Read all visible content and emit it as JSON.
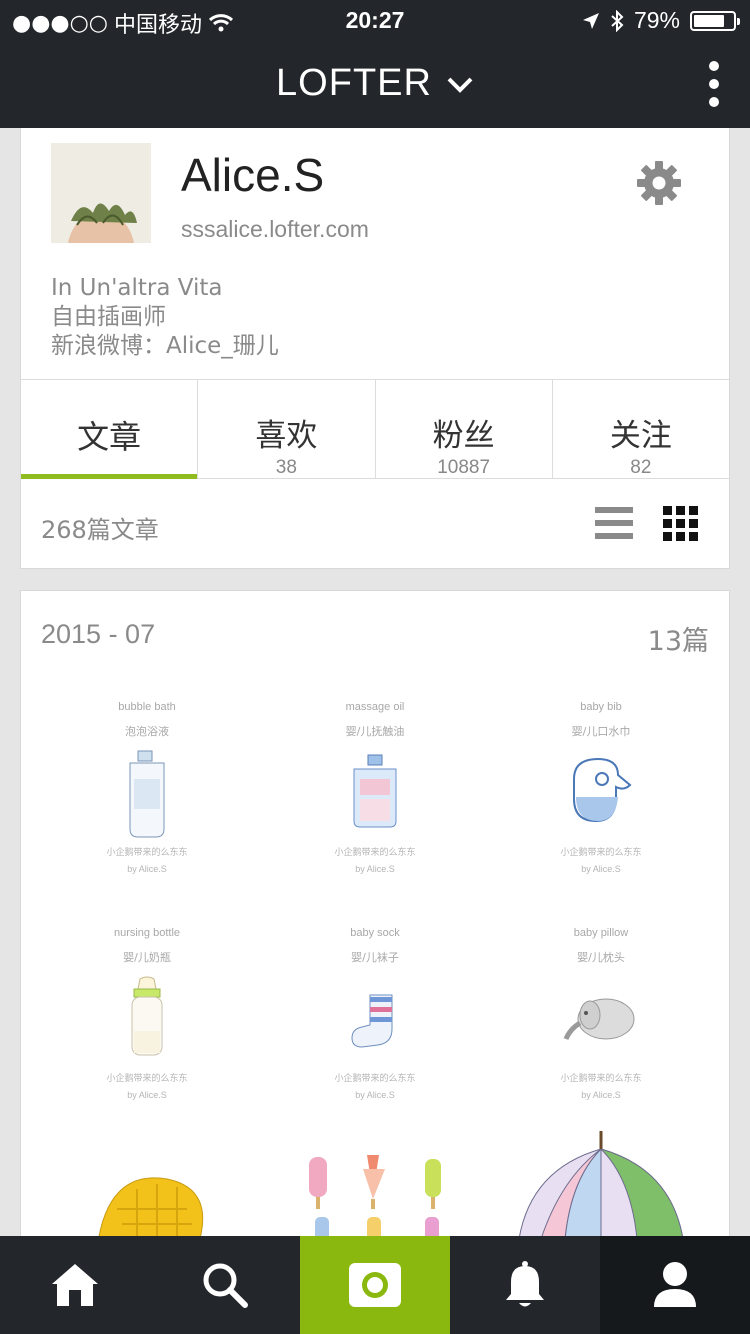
{
  "status_bar": {
    "signal": "●●●○○",
    "carrier": "中国移动",
    "time": "20:27",
    "battery": "79%",
    "battery_level": 0.79
  },
  "nav": {
    "title": "LOFTER"
  },
  "profile": {
    "name": "Alice.S",
    "url": "sssalice.lofter.com",
    "bio": [
      "In Un'altra Vita",
      "自由插画师",
      "新浪微博：Alice_珊儿"
    ]
  },
  "tabs": [
    {
      "label": "文章",
      "count": ""
    },
    {
      "label": "喜欢",
      "count": "38"
    },
    {
      "label": "粉丝",
      "count": "10887"
    },
    {
      "label": "关注",
      "count": "82"
    }
  ],
  "post_count": "268篇文章",
  "archive": {
    "month": "2015 - 07",
    "count": "13篇",
    "items": [
      {
        "en": "bubble bath",
        "zh": "泡泡浴液",
        "caption": "小企鹅带来的么东东",
        "by": "by Alice.S"
      },
      {
        "en": "massage oil",
        "zh": "婴/儿抚触油",
        "caption": "小企鹅带来的么东东",
        "by": "by Alice.S"
      },
      {
        "en": "baby bib",
        "zh": "婴/儿口水巾",
        "caption": "小企鹅带来的么东东",
        "by": "by Alice.S"
      },
      {
        "en": "nursing bottle",
        "zh": "婴/儿奶瓶",
        "caption": "小企鹅带来的么东东",
        "by": "by Alice.S"
      },
      {
        "en": "baby sock",
        "zh": "婴/儿袜子",
        "caption": "小企鹅带来的么东东",
        "by": "by Alice.S"
      },
      {
        "en": "baby pillow",
        "zh": "婴/儿枕头",
        "caption": "小企鹅带来的么东东",
        "by": "by Alice.S"
      }
    ]
  },
  "tabbar": {
    "items": [
      "home-icon",
      "search-icon",
      "camera-icon",
      "bell-icon",
      "person-icon"
    ]
  },
  "colors": {
    "accent": "#8ab80e",
    "bar": "#23272b"
  }
}
